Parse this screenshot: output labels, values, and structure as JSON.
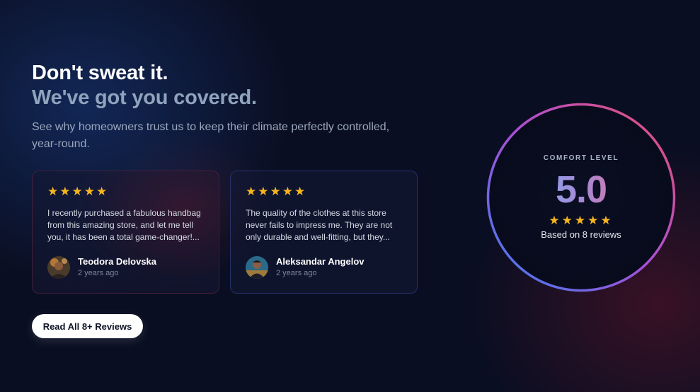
{
  "hero": {
    "title_line1": "Don't sweat it.",
    "title_line2": "We've got you covered.",
    "subtitle": "See why homeowners trust us to keep their climate perfectly controlled, year-round."
  },
  "reviews": [
    {
      "rating": 5,
      "stars": "★★★★★",
      "text": "I recently purchased a fabulous handbag from this amazing store, and let me tell you, it has been a total game-changer!...",
      "author": "Teodora Delovska",
      "time": "2 years ago"
    },
    {
      "rating": 5,
      "stars": "★★★★★",
      "text": "The quality of the clothes at this store never fails to impress me. They are not only durable and well-fitting, but they...",
      "author": "Aleksandar Angelov",
      "time": "2 years ago"
    }
  ],
  "cta": {
    "label": "Read All 8+ Reviews"
  },
  "rating": {
    "label": "COMFORT LEVEL",
    "value": "5.0",
    "stars": "★★★★★",
    "based_on": "Based on 8 reviews"
  },
  "colors": {
    "background": "#0a0e22",
    "star": "#f6b51e",
    "ring_gradient": [
      "#e8516f",
      "#a94fd6",
      "#3b7df0"
    ],
    "accent_text": "#8fa3bd"
  },
  "icons": [
    "star-icon",
    "avatar-image"
  ]
}
